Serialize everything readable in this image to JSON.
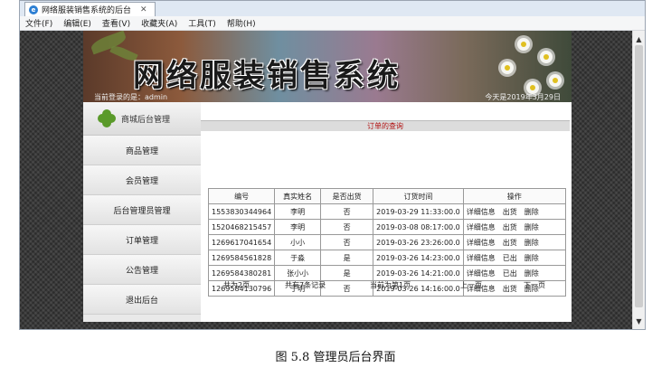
{
  "browser": {
    "tab_title": "网络服装销售系统的后台",
    "menu": [
      "文件(F)",
      "编辑(E)",
      "查看(V)",
      "收藏夹(A)",
      "工具(T)",
      "帮助(H)"
    ]
  },
  "banner": {
    "title": "网络服装销售系统",
    "user_text": "当前登录的是：admin",
    "date_text": "今天是2019年3月29日"
  },
  "sidebar": {
    "title": "商城后台管理",
    "items": [
      "商品管理",
      "会员管理",
      "后台管理员管理",
      "订单管理",
      "公告管理",
      "退出后台"
    ]
  },
  "main": {
    "heading": "订单的查询",
    "columns": [
      "编号",
      "真实姓名",
      "是否出货",
      "订货时间",
      "操作"
    ],
    "rows": [
      {
        "id": "1553830344964",
        "name": "李明",
        "shipped": "否",
        "time": "2019-03-29 11:33:00.0",
        "ops": [
          "详细信息",
          "出货",
          "删除"
        ]
      },
      {
        "id": "1520468215457",
        "name": "李明",
        "shipped": "否",
        "time": "2019-03-08 08:17:00.0",
        "ops": [
          "详细信息",
          "出货",
          "删除"
        ]
      },
      {
        "id": "1269617041654",
        "name": "小小",
        "shipped": "否",
        "time": "2019-03-26 23:26:00.0",
        "ops": [
          "详细信息",
          "出货",
          "删除"
        ]
      },
      {
        "id": "1269584561828",
        "name": "于淼",
        "shipped": "是",
        "time": "2019-03-26 14:23:00.0",
        "ops": [
          "详细信息",
          "已出",
          "删除"
        ]
      },
      {
        "id": "1269584380281",
        "name": "张小小",
        "shipped": "是",
        "time": "2019-03-26 14:21:00.0",
        "ops": [
          "详细信息",
          "已出",
          "删除"
        ]
      },
      {
        "id": "1269584130796",
        "name": "于明",
        "shipped": "否",
        "time": "2019-03-26 14:16:00.0",
        "ops": [
          "详细信息",
          "出货",
          "删除"
        ]
      }
    ],
    "pager": {
      "pages": "共为2页",
      "records": "共有7条记录",
      "current": "当前为第1页",
      "prev": "上一页",
      "next": "下一页"
    }
  },
  "caption": "图 5.8 管理员后台界面"
}
